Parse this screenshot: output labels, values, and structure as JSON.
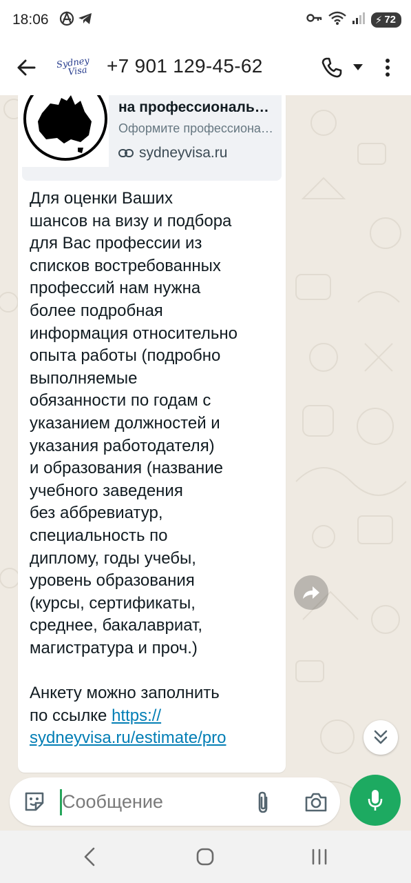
{
  "status_bar": {
    "time": "18:06",
    "battery": "72",
    "icons": [
      "anarchy-icon",
      "telegram-icon",
      "key-icon",
      "wifi-icon",
      "signal-icon",
      "battery-icon"
    ]
  },
  "header": {
    "avatar_line1": "Sydney",
    "avatar_line2": "Visa",
    "contact": "+7 901 129-45-62",
    "icons": [
      "back-arrow-icon",
      "phone-icon",
      "caret-down-icon",
      "more-vertical-icon"
    ]
  },
  "message": {
    "preview": {
      "title": "на профессиональную визу",
      "description": "Оформите профессиональную визу в Австралию",
      "url": "sydneyvisa.ru",
      "icons": [
        "australia-map-icon",
        "link-icon"
      ]
    },
    "body": "Для оценки Ваших\nшансов на визу и подбора\nдля Вас профессии из\nсписков востребованных\nпрофессий нам нужна\nболее подробная\nинформация относительно\nопыта работы (подробно\nвыполняемые\nобязанности по годам с\nуказанием должностей и\nуказания работодателя)\nи образования (название\nучебного заведения\nбез аббревиатур,\nспециальность по\nдиплому, годы учебы,\nуровень образования\n(курсы, сертификаты,\nсреднее, бакалавриат,\nмагистратура и проч.)\n\nАнкету можно заполнить\nпо ссылке ",
    "link_text": "https://\nsydneyvisa.ru/estimate/pro"
  },
  "chat_actions": {
    "icons": [
      "forward-icon",
      "double-chevron-down-icon"
    ]
  },
  "composer": {
    "placeholder": "Сообщение",
    "icons": [
      "sticker-icon",
      "paperclip-icon",
      "camera-icon",
      "microphone-icon"
    ],
    "accent_color": "#1daa61"
  },
  "nav_bar": {
    "icons": [
      "nav-back-icon",
      "nav-home-icon",
      "nav-recents-icon"
    ]
  }
}
